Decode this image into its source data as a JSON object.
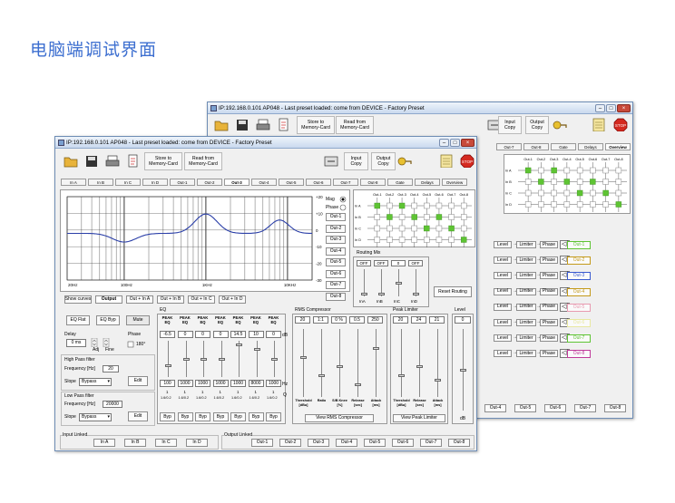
{
  "page": {
    "heading": "电脑端调试界面"
  },
  "back_window": {
    "title": "IP:192.168.0.101  AP048  -  Last preset loaded: come from DEVICE - Factory Preset",
    "toolbar": {
      "store": "Store to\nMemory-Card",
      "read": "Read from\nMemory-Card",
      "input_copy": "Input\nCopy",
      "output_copy": "Output\nCopy"
    },
    "tabs": [
      "Out-7",
      "Out-8",
      "Gate",
      "Delays",
      "Overview"
    ],
    "matrix_cols": [
      "Out-1",
      "Out-2",
      "Out-3",
      "Out-4",
      "Out-5",
      "Out-6",
      "Out-7",
      "Out-8"
    ],
    "matrix_rows": [
      "In A",
      "In B",
      "In C",
      "In D"
    ],
    "chain_labels": {
      "level": "Level",
      "limiter": "Limiter",
      "phase": "Phase"
    },
    "outputs": [
      "Out-1",
      "Out-2",
      "Out-3",
      "Out-4",
      "Out-5",
      "Out-6",
      "Out-7",
      "Out-8"
    ],
    "bottom_buttons": [
      "Out-4",
      "Out-5",
      "Out-6",
      "Out-7",
      "Out-8"
    ]
  },
  "front_window": {
    "title": "IP:192.168.0.101  AP048  -  Last preset loaded: come from DEVICE - Factory Preset",
    "toolbar": {
      "store": "Store to\nMemory-Card",
      "read": "Read from\nMemory-Card",
      "input_copy": "Input\nCopy",
      "output_copy": "Output\nCopy"
    },
    "tabs": [
      "In A",
      "In B",
      "In C",
      "In D",
      "Out-1",
      "Out-2",
      "Out-3",
      "Out-4",
      "Out-5",
      "Out-6",
      "Out-7",
      "Out-8",
      "Gate",
      "Delays",
      "Overview"
    ],
    "selected_tab": "Out-3",
    "graph": {
      "y_ticks": [
        "+20",
        "+10",
        "0",
        "-10",
        "-20",
        "-30"
      ],
      "x_ticks": [
        "20Hz",
        "100Hz",
        "1KHz",
        "10KHz"
      ],
      "mag": "Mag",
      "phase": "Phase"
    },
    "out_buttons": [
      "Out-1",
      "Out-2",
      "Out-3",
      "Out-4",
      "Out-5",
      "Out-6",
      "Out-7",
      "Out-8"
    ],
    "show_buttons": [
      "Show curves",
      "Output",
      "Out + In A",
      "Out + In B",
      "Out + In C",
      "Out + In D"
    ],
    "routing": {
      "cols": [
        "Out-1",
        "Out-2",
        "Out-3",
        "Out-4",
        "Out-5",
        "Out-6",
        "Out-7",
        "Out-8"
      ],
      "rows": [
        "In A",
        "In B",
        "In C",
        "In D"
      ]
    },
    "routing_mix": {
      "title": "Routing Mix",
      "values": [
        "OFF",
        "OFF",
        "0",
        "OFF"
      ],
      "labels": [
        "InA",
        "InB",
        "InC",
        "InD"
      ],
      "reset": "Reset Routing"
    },
    "eq": {
      "title": "EQ",
      "flat": "EQ Flat",
      "byp": "EQ Byp",
      "mute": "Mute",
      "band_labels": [
        "PEAK\nEQ",
        "PEAK\nEQ",
        "PEAK\nEQ",
        "PEAK\nEQ",
        "PEAK\nEQ",
        "PEAK\nEQ",
        "PEAK\nEQ"
      ],
      "gains": [
        "-6.5",
        "0",
        "0",
        "0",
        "14.5",
        "10",
        "0"
      ],
      "db": "dB",
      "freqs": [
        "100",
        "1000",
        "1000",
        "1000",
        "1000",
        "8000",
        "1000"
      ],
      "hz": "Hz",
      "qs": [
        "1",
        "1",
        "1",
        "1",
        "1",
        "1",
        "1"
      ],
      "q": "Q",
      "q_labels": [
        "1.6/0.2",
        "1.6/0.2",
        "1.6/0.2",
        "1.6/0.2",
        "1.6/0.2",
        "1.6/0.2",
        "1.6/0.2"
      ],
      "byp_buttons": [
        "Byp",
        "Byp",
        "Byp",
        "Byp",
        "Byp",
        "Byp",
        "Byp"
      ]
    },
    "delay": {
      "title": "Delay",
      "value": "0 ms",
      "adj": "Adj",
      "fine": "Fine"
    },
    "phase": {
      "title": "Phase",
      "value": "180°"
    },
    "hpf": {
      "title": "High Pass filter",
      "freq_label": "Frequency [Hz]",
      "freq": "20",
      "slope_label": "Slope",
      "slope": "Bypass",
      "edit": "Edit"
    },
    "lpf": {
      "title": "Low Pass filter",
      "freq_label": "Frequency [Hz]",
      "freq": "20000",
      "slope_label": "Slope",
      "slope": "Bypass",
      "edit": "Edit"
    },
    "compressor": {
      "title": "RMS Compressor",
      "values": [
        "20",
        "1:1",
        "0 %",
        "0.5",
        "250"
      ],
      "labels": [
        "Threshold\n[dBu]",
        "Ratio",
        "S/B Knee\n[%]",
        "Release\n[sec]",
        "Attack\n[ms]"
      ],
      "view": "View RMS Compressor"
    },
    "limiter": {
      "title": "Peak Limiter",
      "values": [
        "20",
        "24",
        "21"
      ],
      "labels": [
        "Threshold\n[dBu]",
        "Release\n[sec]",
        "Attack\n[ms]"
      ],
      "view": "View Peak Limiter"
    },
    "level": {
      "title": "Level",
      "value": "0",
      "db": "dB"
    },
    "input_linked": {
      "title": "Input Linked",
      "buttons": [
        "In A",
        "In B",
        "In C",
        "In D"
      ]
    },
    "output_linked": {
      "title": "Output Linked",
      "buttons": [
        "Out-1",
        "Out-2",
        "Out-3",
        "Out-4",
        "Out-5",
        "Out-6",
        "Out-7",
        "Out-8"
      ]
    }
  },
  "colors": {
    "curve": "#2b3fa8",
    "accent": "#5ec433",
    "heading": "#3d6fd0",
    "tab_swatches": [
      "#8b1a1a",
      "#c0306e",
      "#1a2a9a",
      "#6a2aa0",
      "#2a8a2a",
      "#1a9a8a",
      "#3a3a9a",
      "#c49a1a",
      "#2a9a3a",
      "#c03a9a",
      "#3a2a8a",
      "#2a8a9a",
      "#9a3a3a",
      "#8a6a2a",
      "#5a5a5a"
    ]
  }
}
